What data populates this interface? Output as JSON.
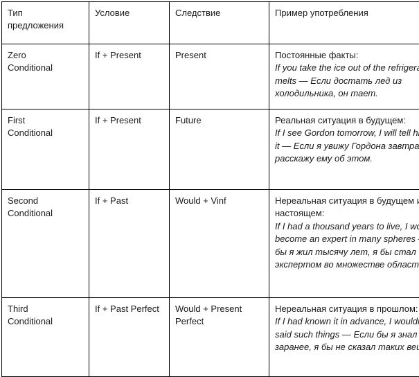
{
  "table": {
    "columns": [
      {
        "key": "type",
        "header": "Тип\nпредложения"
      },
      {
        "key": "condition",
        "header": "Условие"
      },
      {
        "key": "result",
        "header": "Следствие"
      },
      {
        "key": "example",
        "header": "Пример употребления"
      }
    ],
    "rows": [
      {
        "type": "Zero\nConditional",
        "condition": "If + Present",
        "result": "Present",
        "example_intro": "Постоянные факты:",
        "example_sentence": "If you take the ice out of the refrigerator, it melts — Если достать лед из холодильника, он тает."
      },
      {
        "type": "First\nConditional",
        "condition": "If + Present",
        "result": "Future",
        "example_intro": "Реальная ситуация в будущем:",
        "example_sentence": "If I see Gordon tomorrow, I will tell him about it — Если я увижу Гордона завтра, я расскажу ему об этом."
      },
      {
        "type": "Second\nConditional",
        "condition": "If + Past",
        "result": "Would + Vinf",
        "example_intro": "Нереальная ситуация в будущем или настоящем:",
        "example_sentence": "If I had a thousand years to live, I would become an expert in many spheres — Если бы я жил тысячу лет, я бы стал экспертом во множестве областей."
      },
      {
        "type": "Third\nConditional",
        "condition": "If + Past Perfect",
        "result": "Would + Present Perfect",
        "example_intro": "Нереальная ситуация в прошлом:",
        "example_sentence": "If I had known it in advance, I wouldn’t have said such things — Если бы я знал об этом заранее, я бы не сказал таких вещей."
      }
    ]
  },
  "colors": {
    "border": "#000000",
    "text": "#1a1a1a",
    "background": "#ffffff"
  }
}
